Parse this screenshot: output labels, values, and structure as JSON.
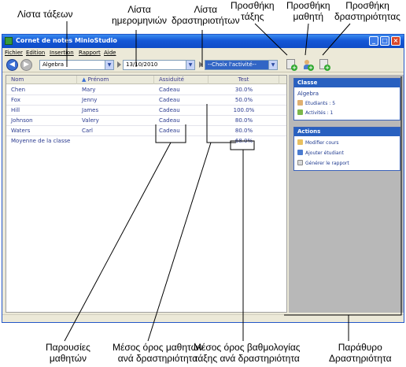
{
  "annotations": {
    "class_list": "Λίστα τάξεων",
    "date_list": "Λίστα\nημερομηνιών",
    "activity_list": "Λίστα\nδραστηριοτήτων",
    "add_class": "Προσθήκη\nτάξης",
    "add_student": "Προσθήκη\nμαθητή",
    "add_activity": "Προσθήκη\nδραστηριότητας",
    "attendance": "Παρουσίες\nμαθητών",
    "student_avg": "Μέσος όρος μαθητών\nανά δραστηριότητα",
    "class_avg": "Μέσος όρος βαθμολογίας\nτάξης ανά δραστηριότητα",
    "activity_window": "Παράθυρο\nΔραστηριότητα"
  },
  "window": {
    "title": "Cornet de notes MinioStudio"
  },
  "menu": [
    "Fichier",
    "Edition",
    "Insertion",
    "Rapport",
    "Aide"
  ],
  "toolbar": {
    "class_value": "Algebra",
    "date_value": "13/10/2010",
    "activity_value": "--Choix l'activité--"
  },
  "table": {
    "headers": [
      "Nom",
      "Prénom",
      "Assiduité",
      "Test"
    ],
    "rows": [
      {
        "nom": "Chen",
        "prenom": "Mary",
        "assiduite": "Cadeau",
        "test": "30.0%"
      },
      {
        "nom": "Fox",
        "prenom": "Jenny",
        "assiduite": "Cadeau",
        "test": "50.0%"
      },
      {
        "nom": "Hill",
        "prenom": "James",
        "assiduite": "Cadeau",
        "test": "100.0%"
      },
      {
        "nom": "Johnson",
        "prenom": "Valery",
        "assiduite": "Cadeau",
        "test": "80.0%"
      },
      {
        "nom": "Waters",
        "prenom": "Carl",
        "assiduite": "Cadeau",
        "test": "80.0%"
      }
    ],
    "average_label": "Moyenne de la classe",
    "average_value": "68.0%"
  },
  "side": {
    "classe_header": "Classe",
    "class_name": "Algebra",
    "students": "Etudiants : 5",
    "activities": "Activités : 1",
    "actions_header": "Actions",
    "action_1": "Modifier cours",
    "action_2": "Ajouter étudiant",
    "action_3": "Générer le rapport"
  }
}
